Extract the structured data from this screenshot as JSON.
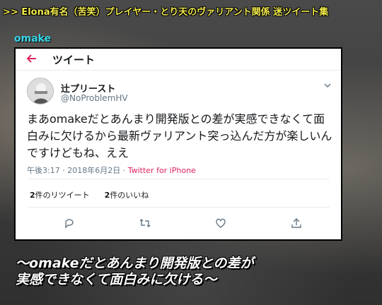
{
  "banner": {
    "text": ">> Elona有名（苦笑）プレイヤー・とり天のヴァリアント関係 迷ツイート集"
  },
  "section_label": "omake",
  "tweet_page": {
    "header_title": "ツイート",
    "user": {
      "display_name": "辻プリースト",
      "handle": "@NoProblemHV"
    },
    "text": "まあomakeだとあんまり開発版との差が実感できなくて面白みに欠けるから最新ヴァリアント突っ込んだ方が楽しいんですけどもね、ええ",
    "time": "午後3:17",
    "dot1": "·",
    "date": "2018年6月2日",
    "dot2": "·",
    "via": "Twitter for iPhone",
    "retweets": {
      "count": "2",
      "label": "件のリツイート"
    },
    "likes": {
      "count": "2",
      "label": "件のいいね"
    }
  },
  "caption": {
    "line1": "～omakeだとあんまり開発版との差が",
    "line2": "実感できなくて面白みに欠ける～"
  },
  "colors": {
    "banner": "#f1e94b",
    "section_label": "#35d6e8",
    "accent": "#e0245e"
  },
  "icons": {
    "back": "arrow-left-icon",
    "caret": "chevron-down-icon",
    "reply": "reply-icon",
    "retweet": "retweet-icon",
    "like": "heart-icon",
    "share": "share-icon"
  }
}
